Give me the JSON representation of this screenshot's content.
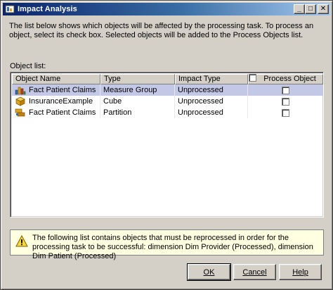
{
  "window": {
    "title": "Impact Analysis",
    "minimize_glyph": "_",
    "maximize_glyph": "□",
    "close_glyph": "✕"
  },
  "description": "The list below shows which objects will be affected by the processing task. To process an object, select its check box. Selected objects will be added to the Process Objects list.",
  "object_list": {
    "caption": "Object list:",
    "columns": [
      "Object Name",
      "Type",
      "Impact Type",
      "Process Object"
    ],
    "rows": [
      {
        "name": "Fact Patient Claims",
        "type": "Measure Group",
        "impact": "Unprocessed",
        "process": false,
        "icon": "measure-group-icon",
        "selected": true
      },
      {
        "name": "InsuranceExample",
        "type": "Cube",
        "impact": "Unprocessed",
        "process": false,
        "icon": "cube-icon",
        "selected": false
      },
      {
        "name": "Fact Patient Claims",
        "type": "Partition",
        "impact": "Unprocessed",
        "process": false,
        "icon": "partition-icon",
        "selected": false
      }
    ]
  },
  "warning": {
    "icon": "warning-icon",
    "text": "The following list contains objects that must be reprocessed in order for the processing task to be successful: dimension Dim Provider (Processed), dimension Dim Patient (Processed)"
  },
  "buttons": {
    "ok": "OK",
    "cancel": "Cancel",
    "help": "Help"
  },
  "colors": {
    "title_start": "#0a246a",
    "title_end": "#a6caf0",
    "selected_row": "#c2c8e6",
    "warning_bg": "#ffffe1"
  }
}
